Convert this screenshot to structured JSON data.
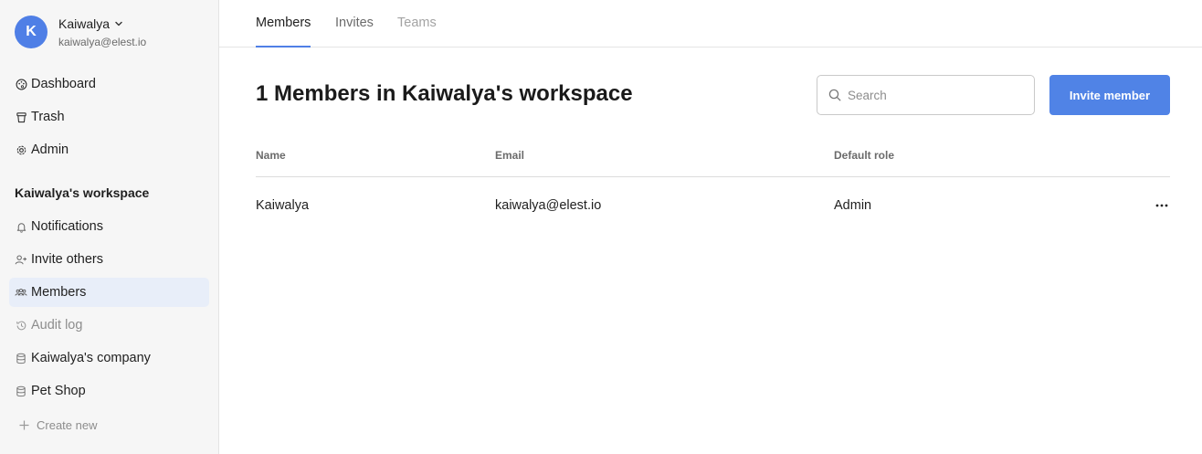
{
  "user": {
    "initial": "K",
    "name": "Kaiwalya",
    "email": "kaiwalya@elest.io"
  },
  "sidebar": {
    "top_items": [
      {
        "label": "Dashboard",
        "icon": "palette-icon"
      },
      {
        "label": "Trash",
        "icon": "trash-icon"
      },
      {
        "label": "Admin",
        "icon": "gear-icon"
      }
    ],
    "workspace_title": "Kaiwalya's workspace",
    "workspace_items": [
      {
        "label": "Notifications",
        "icon": "bell-icon"
      },
      {
        "label": "Invite others",
        "icon": "user-plus-icon"
      },
      {
        "label": "Members",
        "icon": "users-icon",
        "active": true
      },
      {
        "label": "Audit log",
        "icon": "history-icon",
        "muted": true
      },
      {
        "label": "Kaiwalya's company",
        "icon": "database-icon"
      },
      {
        "label": "Pet Shop",
        "icon": "database-icon"
      }
    ],
    "create_new": "Create new"
  },
  "tabs": [
    {
      "label": "Members",
      "state": "active"
    },
    {
      "label": "Invites",
      "state": "normal"
    },
    {
      "label": "Teams",
      "state": "disabled"
    }
  ],
  "main": {
    "title": "1 Members in Kaiwalya's workspace",
    "search_placeholder": "Search",
    "invite_button": "Invite member"
  },
  "table": {
    "columns": [
      "Name",
      "Email",
      "Default role"
    ],
    "rows": [
      {
        "name": "Kaiwalya",
        "email": "kaiwalya@elest.io",
        "role": "Admin"
      }
    ]
  },
  "colors": {
    "accent": "#5083e6",
    "active_nav_bg": "#e8eef9",
    "sidebar_bg": "#f6f6f6"
  }
}
